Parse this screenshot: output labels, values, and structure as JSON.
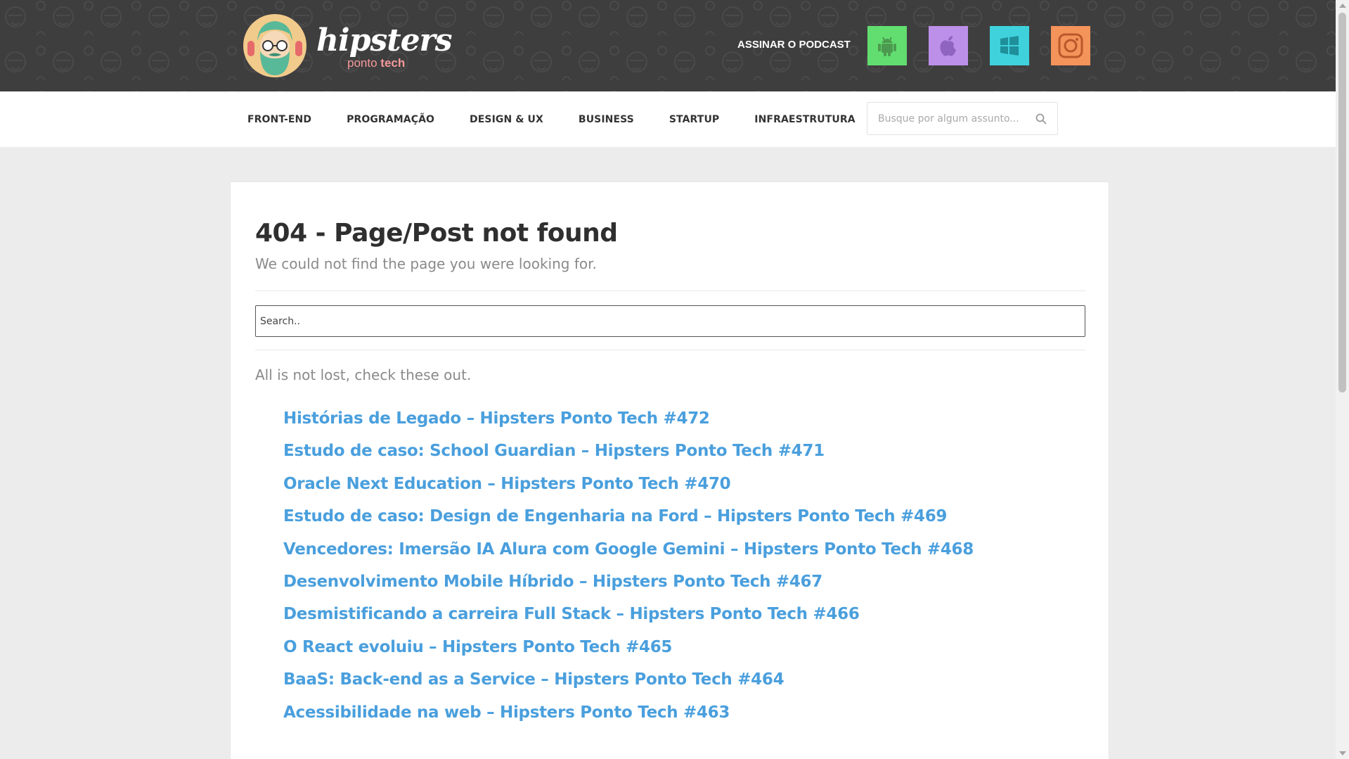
{
  "header": {
    "logo_word": "hipsters",
    "logo_sub_plain": "ponto",
    "logo_sub_bold": "tech",
    "subscribe_label": "ASSINAR O PODCAST",
    "platforms": [
      {
        "name": "android",
        "color": "#62de70"
      },
      {
        "name": "apple",
        "color": "#bc8fe8"
      },
      {
        "name": "windows",
        "color": "#3fd2dd"
      },
      {
        "name": "instagram",
        "color": "#f4935a"
      }
    ]
  },
  "nav": {
    "items": [
      "FRONT-END",
      "PROGRAMAÇÃO",
      "DESIGN & UX",
      "BUSINESS",
      "STARTUP",
      "INFRAESTRUTURA"
    ],
    "search_placeholder": "Busque por algum assunto..."
  },
  "main": {
    "title": "404 - Page/Post not found",
    "subtitle": "We could not find the page you were looking for.",
    "search_placeholder": "Search..",
    "lost_text": "All is not lost, check these out.",
    "link_color": "#4a9fdd",
    "posts": [
      "Histórias de Legado – Hipsters Ponto Tech #472",
      "Estudo de caso: School Guardian – Hipsters Ponto Tech #471",
      "Oracle Next Education – Hipsters Ponto Tech #470",
      "Estudo de caso: Design de Engenharia na Ford – Hipsters Ponto Tech #469",
      "Vencedores: Imersão IA Alura com Google Gemini – Hipsters Ponto Tech #468",
      "Desenvolvimento Mobile Híbrido – Hipsters Ponto Tech #467",
      "Desmistificando a carreira Full Stack – Hipsters Ponto Tech #466",
      "O React evoluiu – Hipsters Ponto Tech #465",
      "BaaS: Back-end as a Service – Hipsters Ponto Tech #464",
      "Acessibilidade na web – Hipsters Ponto Tech #463"
    ]
  }
}
